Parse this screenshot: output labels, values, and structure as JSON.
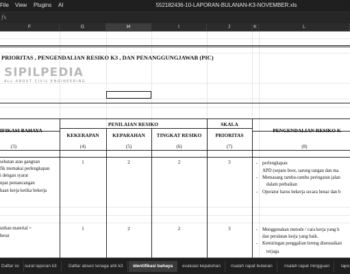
{
  "menu": {
    "file": "File",
    "view": "View",
    "plugins": "Plugins",
    "ai": "AI"
  },
  "file_title": "552182436-10-LAPORAN-BULANAN-K3-NOVEMBER.xls",
  "formula": {
    "fx": "fx"
  },
  "columns": [
    "F",
    "G",
    "H",
    "I",
    "J",
    "K",
    "L"
  ],
  "sheet": {
    "heading": "PRIORITAS , PENGENDALIAN RESIKO K3 , DAN PENANGGUNGJAWAB (PIC)",
    "logo_main": "SIPILPEDIA",
    "logo_sub": "ALL ABOUT CIVIL ENGINEERING",
    "table_headers": {
      "ifikasi_bahaya": "IFIKASI BAHAYA",
      "penilaian_resiko": "PENILAIAN RESIKO",
      "kekerapan": "KEKERAPAN",
      "keparahan": "KEPARAHAN",
      "tingkat_resiko": "TINGKAT RESIKO",
      "skala": "SKALA",
      "prioritas": "PRIORITAS",
      "pengendalian": "PENGENDALIAN RESIKO K"
    },
    "col_numbers": [
      "(3)",
      "(4)",
      "(5)",
      "(6)",
      "(7)",
      "(8)"
    ],
    "left_text": [
      "sehatan atau gangnan",
      "fik memakai perlengkapan",
      "i dengan syarat",
      "npat pemancangan",
      "kaan kerja ketika bekerja",
      "unhan material >",
      "berat"
    ],
    "row1_values": [
      "1",
      "2",
      "2",
      "3"
    ],
    "row2_values": [
      "1",
      "2",
      "2",
      "3"
    ],
    "pengendalian_text": [
      "perlengkapan",
      "APD (sepatu boot,  sarung tangan dan ma",
      "Memasang rambu-rambu peringatan jalan",
      "dalam perbaikan",
      "Operator harus bekerja secara benar dan b",
      "Menggunakan metode / cara kerja yang b",
      "dan peralatan kerja yang baik.",
      "Kemiringan penggalian lereng disesuaikan",
      "terjaga"
    ],
    "bullet": "-"
  },
  "tabs": [
    "Daftar isi",
    "surat laporan k3",
    "Daftar absen tenaga ahli k3",
    "identifikasi bahaya",
    "evaluasi kepatuhan",
    "risalah rapat bulanan",
    "risalah rapat mingguan",
    "lapo"
  ],
  "active_tab": "identifikasi bahaya"
}
